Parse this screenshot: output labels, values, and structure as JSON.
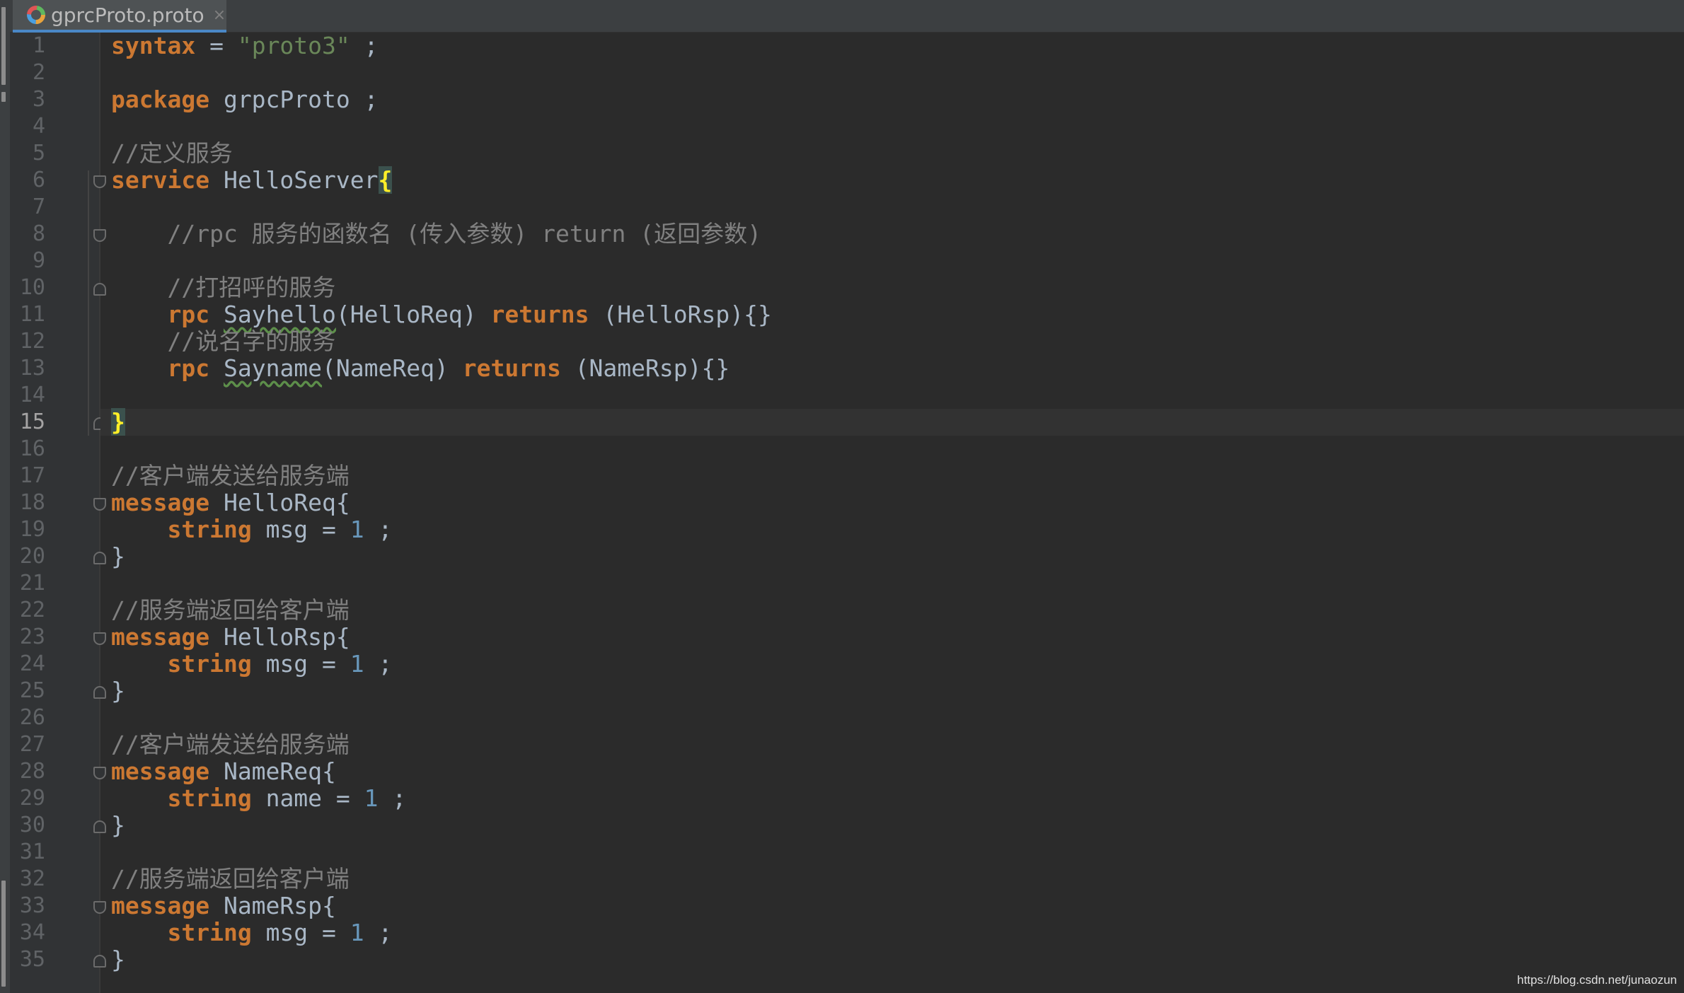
{
  "tab": {
    "filename": "gprcProto.proto",
    "close_glyph": "×",
    "icon": "proto-file-icon"
  },
  "current_line": 15,
  "lines": [
    {
      "n": "1"
    },
    {
      "n": "2"
    },
    {
      "n": "3"
    },
    {
      "n": "4"
    },
    {
      "n": "5"
    },
    {
      "n": "6"
    },
    {
      "n": "7"
    },
    {
      "n": "8"
    },
    {
      "n": "9"
    },
    {
      "n": "10"
    },
    {
      "n": "11"
    },
    {
      "n": "12"
    },
    {
      "n": "13"
    },
    {
      "n": "14"
    },
    {
      "n": "15"
    },
    {
      "n": "16"
    },
    {
      "n": "17"
    },
    {
      "n": "18"
    },
    {
      "n": "19"
    },
    {
      "n": "20"
    },
    {
      "n": "21"
    },
    {
      "n": "22"
    },
    {
      "n": "23"
    },
    {
      "n": "24"
    },
    {
      "n": "25"
    },
    {
      "n": "26"
    },
    {
      "n": "27"
    },
    {
      "n": "28"
    },
    {
      "n": "29"
    },
    {
      "n": "30"
    },
    {
      "n": "31"
    },
    {
      "n": "32"
    },
    {
      "n": "33"
    },
    {
      "n": "34"
    },
    {
      "n": "35"
    }
  ],
  "code": {
    "l1_kw": "syntax",
    "l1_eq": " = ",
    "l1_str": "\"proto3\"",
    "l1_end": " ;",
    "l3_kw": "package",
    "l3_rest": " grpcProto ;",
    "l5_cm": "//定义服务",
    "l6_kw": "service",
    "l6_name": " HelloServer",
    "l6_brace": "{",
    "l8_cm": "    //rpc 服务的函数名 (传入参数) return (返回参数)",
    "l10_cm": "    //打招呼的服务",
    "l11_indent": "    ",
    "l11_kw": "rpc",
    "l11_sp": " ",
    "l11_fn": "Sayhello",
    "l11_args": "(HelloReq) ",
    "l11_kw2": "returns",
    "l11_ret": " (HelloRsp){}",
    "l12_cm": "    //说名字的服务",
    "l13_indent": "    ",
    "l13_kw": "rpc",
    "l13_sp": " ",
    "l13_fn": "Sayname",
    "l13_args": "(NameReq) ",
    "l13_kw2": "returns",
    "l13_ret": " (NameRsp){}",
    "l15_brace": "}",
    "l17_cm": "//客户端发送给服务端",
    "l18_kw": "message",
    "l18_name": " HelloReq{",
    "l19_indent": "    ",
    "l19_kw": "string",
    "l19_rest": " msg = ",
    "l19_num": "1",
    "l19_end": " ;",
    "l20": "}",
    "l22_cm": "//服务端返回给客户端",
    "l23_kw": "message",
    "l23_name": " HelloRsp{",
    "l24_indent": "    ",
    "l24_kw": "string",
    "l24_rest": " msg = ",
    "l24_num": "1",
    "l24_end": " ;",
    "l25": "}",
    "l27_cm": "//客户端发送给服务端",
    "l28_kw": "message",
    "l28_name": " NameReq{",
    "l29_indent": "    ",
    "l29_kw": "string",
    "l29_rest": " name = ",
    "l29_num": "1",
    "l29_end": " ;",
    "l30": "}",
    "l32_cm": "//服务端返回给客户端",
    "l33_kw": "message",
    "l33_name": " NameRsp{",
    "l34_indent": "    ",
    "l34_kw": "string",
    "l34_rest": " msg = ",
    "l34_num": "1",
    "l34_end": " ;",
    "l35": "}"
  },
  "watermark": "https://blog.csdn.net/junaozun",
  "colors": {
    "keyword": "#cc7832",
    "string": "#6a8759",
    "number": "#6897bb",
    "comment": "#808080",
    "text": "#a9b7c6",
    "brace_highlight": "#ffef28"
  }
}
